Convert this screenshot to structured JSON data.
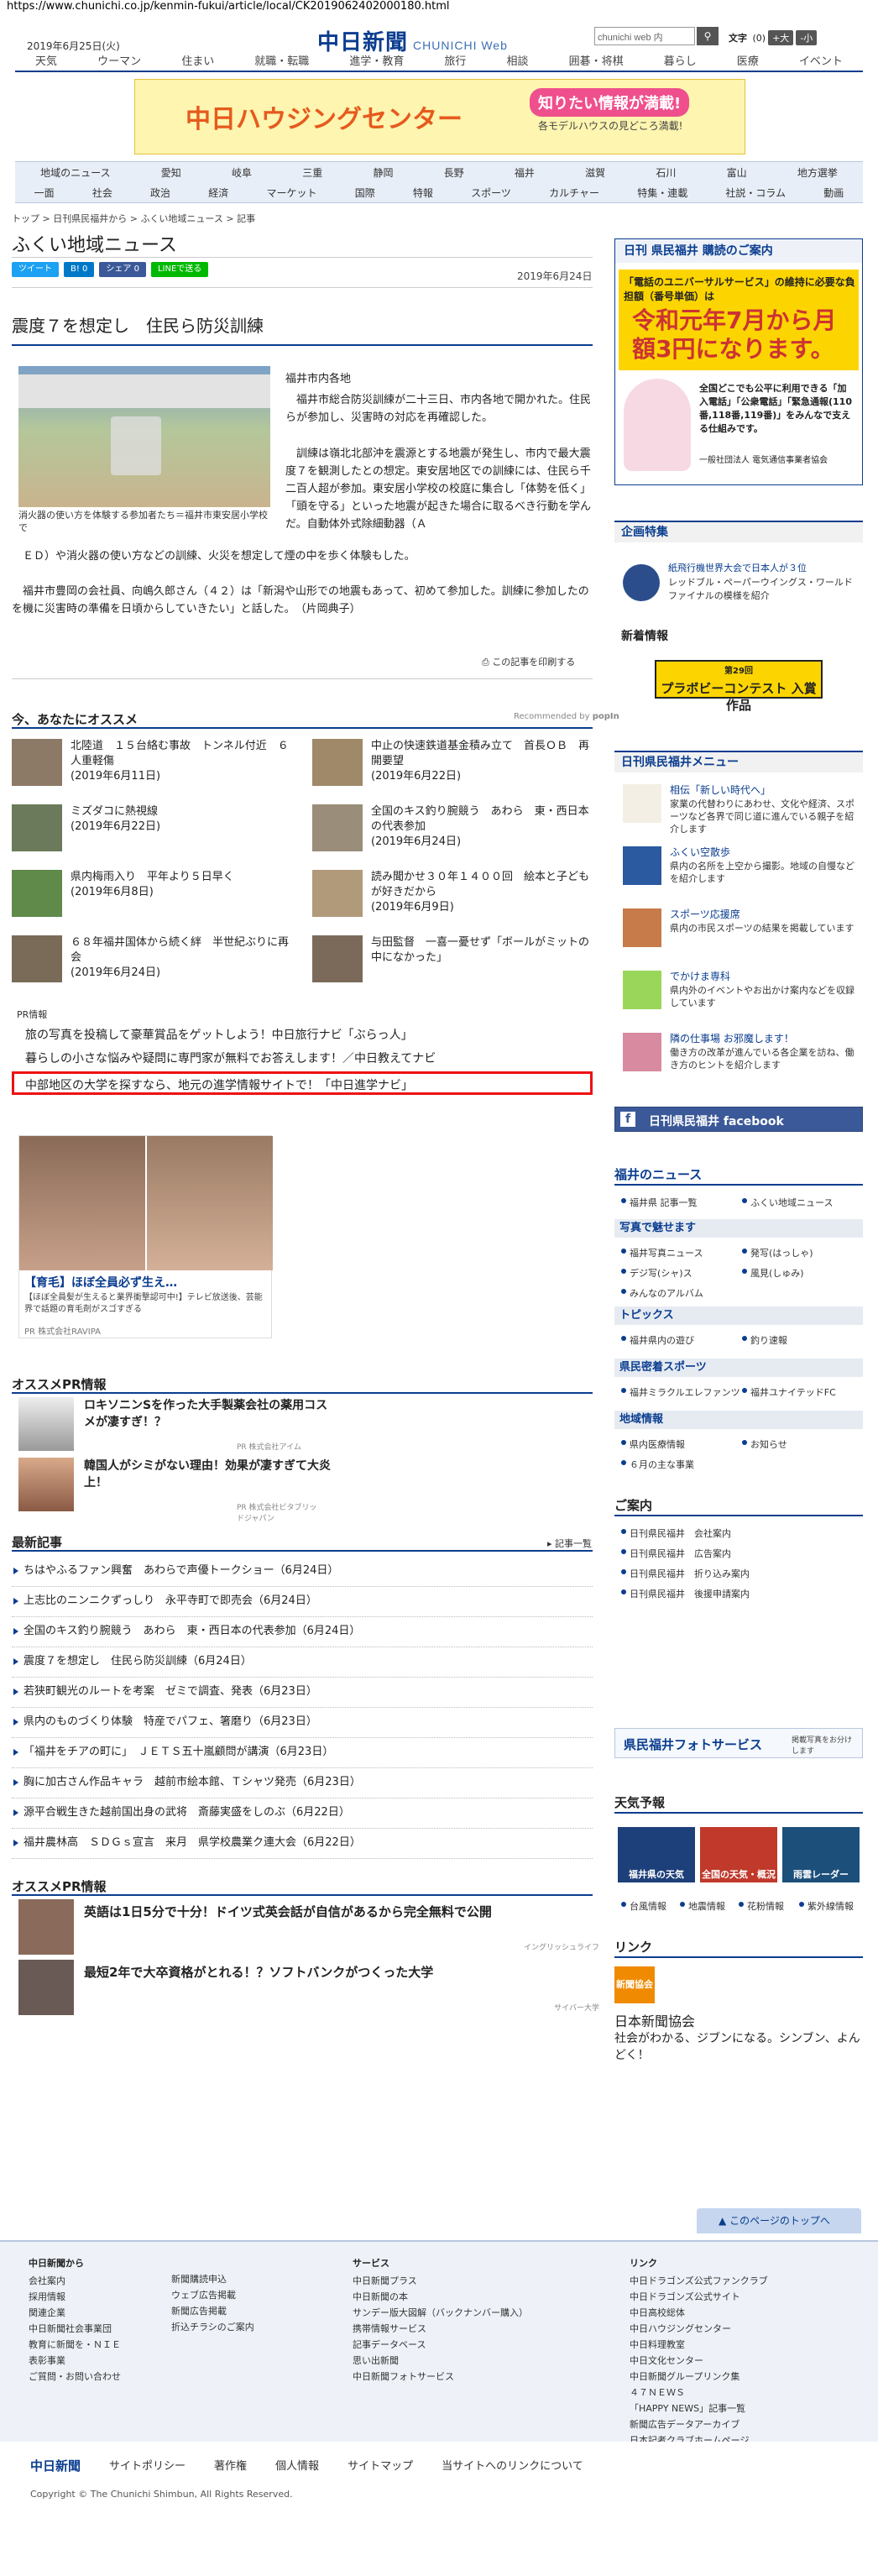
{
  "browser": {
    "url": "https://www.chunichi.co.jp/kenmin-fukui/article/local/CK2019062402000180.html"
  },
  "header": {
    "date": "2019年6月25日(火)",
    "logo": "中日新聞",
    "logo_sub": "CHUNICHI Web",
    "search_placeholder": "chunichi web 内",
    "search_icon": "search-icon",
    "font_label": "文字",
    "font_zero": "(0)",
    "font_large": "+大",
    "font_small": "-小"
  },
  "global_nav": [
    "天気",
    "ウーマン",
    "住まい",
    "就職・転職",
    "進学・教育",
    "旅行",
    "相談",
    "囲碁・将棋",
    "暮らし",
    "医療",
    "イベント"
  ],
  "banner": {
    "title": "中日ハウジングセンター",
    "badge": "知りたい情報が満載!",
    "sub": "各モデルハウスの見どころ満載!"
  },
  "cat_nav": {
    "row1": [
      "地域のニュース",
      "愛知",
      "岐阜",
      "三重",
      "静岡",
      "長野",
      "福井",
      "滋賀",
      "石川",
      "富山",
      "地方選挙"
    ],
    "row2": [
      "一面",
      "社会",
      "政治",
      "経済",
      "マーケット",
      "国際",
      "特報",
      "スポーツ",
      "カルチャー",
      "特集・連載",
      "社説・コラム",
      "動画"
    ]
  },
  "breadcrumb": "トップ > 日刊県民福井から > ふくい地域ニュース > 記事",
  "page_title": "ふくい地域ニュース",
  "social": {
    "tweet": "ツイート",
    "bookmark": "B! 0",
    "share": "シェア 0",
    "line": "LINEで送る"
  },
  "published": "2019年6月24日",
  "article": {
    "title": "震度７を想定し　住民ら防災訓練",
    "byline": "福井市内各地",
    "caption": "消火器の使い方を体験する参加者たち＝福井市東安居小学校で",
    "para1": "福井市総合防災訓練が二十三日、市内各地で開かれた。住民らが参加し、災害時の対応を再確認した。",
    "para2": "訓練は嶺北北部沖を震源とする地震が発生し、市内で最大震度７を観測したとの想定。東安居地区での訓練には、住民ら千二百人超が参加。東安居小学校の校庭に集合し「体勢を低く」「頭を守る」といった地震が起きた場合に取るべき行動を学んだ。自動体外式除細動器（Ａ",
    "para2b": "ＥＤ）や消火器の使い方などの訓練、火災を想定して煙の中を歩く体験もした。",
    "para3": "福井市豊岡の会社員、向嶋久郎さん（４２）は「新潟や山形での地震もあって、初めて参加した。訓練に参加したのを機に災害時の準備を日頃からしていきたい」と話した。　（片岡典子）",
    "print": "この記事を印刷する"
  },
  "reco": {
    "heading": "今、あなたにオススメ",
    "powered": "Recommended by",
    "powered_by": "popIn",
    "items": [
      {
        "title": "北陸道　１５台絡む事故　トンネル付近　６人重軽傷",
        "date": "(2019年6月11日)"
      },
      {
        "title": "中止の快速鉄道基金積み立て　首長ＯＢ　再開要望",
        "date": "(2019年6月22日)"
      },
      {
        "title": "ミズダコに熱視線",
        "date": "(2019年6月22日)"
      },
      {
        "title": "全国のキス釣り腕競う　あわら　東・西日本の代表参加",
        "date": "(2019年6月24日)"
      },
      {
        "title": "県内梅雨入り　平年より５日早く",
        "date": "(2019年6月8日)"
      },
      {
        "title": "読み聞かせ３０年１４００回　絵本と子どもが好きだから",
        "date": "(2019年6月9日)"
      },
      {
        "title": "６８年福井国体から続く絆　半世紀ぶりに再会",
        "date": "(2019年6月24日)"
      },
      {
        "title": "与田監督　一喜一憂せず「ボールがミットの中になかった」",
        "date": ""
      }
    ]
  },
  "pr": {
    "label": "PR情報",
    "links": [
      "旅の写真を投稿して豪華賞品をゲットしよう！中日旅行ナビ「ぶらっ人」",
      "暮らしの小さな悩みや疑問に専門家が無料でお答えします！／中日教えてナビ",
      "中部地区の大学を探すなら、地元の進学情報サイトで！「中日進学ナビ」"
    ]
  },
  "ad": {
    "headline": "【育毛】ほぼ全員必ず生え…",
    "desc": "【ほぼ全員髪が生えると業界衝撃認可中!】テレビ放送後、芸能界で話題の育毛剤がスゴすぎる",
    "sponsor": "PR 株式会社RAVIPA"
  },
  "osusume_pr": {
    "heading": "オススメPR情報",
    "items": [
      {
        "title": "ロキソニンSを作った大手製薬会社の薬用コスメが凄すぎ！？",
        "sponsor": "PR 株式会社アイム"
      },
      {
        "title": "韓国人がシミがない理由！効果が凄すぎて大炎上！",
        "sponsor": "PR 株式会社ビタブリッドジャパン"
      }
    ]
  },
  "latest": {
    "heading": "最新記事",
    "more": "記事一覧",
    "items": [
      "ちはやふるファン興奮　あわらで声優トークショー（6月24日）",
      "上志比のニンニクずっしり　永平寺町で即売会（6月24日）",
      "全国のキス釣り腕競う　あわら　東・西日本の代表参加（6月24日）",
      "震度７を想定し　住民ら防災訓練（6月24日）",
      "若狭町観光のルートを考案　ゼミで調査、発表（6月23日）",
      "県内のものづくり体験　特産でパフェ、箸磨り（6月23日）",
      "「福井をチアの町に」　ＪＥＴＳ五十嵐顧問が講演（6月23日）",
      "胸に加古さん作品キャラ　越前市絵本館、Ｔシャツ発売（6月23日）",
      "源平合戦生きた越前国出身の武将　斎藤実盛をしのぶ（6月22日）",
      "福井農林高　ＳＤＧｓ宣言　来月　県学校農業ク連大会（6月22日）"
    ]
  },
  "osusume_pr2": {
    "heading": "オススメPR情報",
    "items": [
      {
        "title": "英語は1日5分で十分！ドイツ式英会話が自信があるから完全無料で公開",
        "sponsor": "イングリッシュライフ"
      },
      {
        "title": "最短2年で大卒資格がとれる！？ソフトバンクがつくった大学",
        "sponsor": "サイバー大学"
      }
    ]
  },
  "sidebar": {
    "subscribe": {
      "heading": "日刊 県民福井 購読のご案内",
      "notice": "「電話のユニバーサルサービス」の維持に必要な負担額（番号単価）は",
      "price": "令和元年7月から月額3円になります。",
      "body": "全国どこでも公平に利用できる「加入電話」「公衆電話」「緊急通報(110番,118番,119番)」をみんなで支える仕組みです。",
      "org": "一般社団法人 電気通信事業者協会"
    },
    "kikaku": {
      "heading": "企画特集",
      "title": "紙飛行機世界大会で日本人が３位",
      "desc": "レッドブル・ペーパーウイングス・ワールドファイナルの模様を紹介"
    },
    "shinchaku": {
      "heading": "新着情報",
      "contest_line1": "第29回",
      "contest_line2": "プラボビーコンテスト",
      "contest_line3": "入賞作品"
    },
    "menu": {
      "heading": "日刊県民福井メニュー",
      "items": [
        {
          "title": "相伝「新しい時代へ」",
          "desc": "家業の代替わりにあわせ、文化や経済、スポーツなど各界で同じ道に進んでいる親子を紹介します"
        },
        {
          "title": "ふくい空散歩",
          "desc": "県内の名所を上空から撮影。地域の自慢などを紹介します"
        },
        {
          "title": "スポーツ応援席",
          "desc": "県内の市民スポーツの結果を掲載しています"
        },
        {
          "title": "でかけま専科",
          "desc": "県内外のイベントやお出かけ案内などを収録しています"
        },
        {
          "title": "隣の仕事場 お邪魔します！",
          "desc": "働き方の改革が進んでいる各企業を訪ね、働き方のヒントを紹介します"
        }
      ]
    },
    "facebook": "日刊県民福井 facebook",
    "fukui_news": {
      "heading": "福井のニュース",
      "links": [
        "福井県 記事一覧",
        "ふくい地域ニュース"
      ],
      "photo_h": "写真で魅せます",
      "photo_links": [
        "福井写真ニュース",
        "発写(はっしゃ)",
        "デジ写(シャ)ス",
        "風見(しゅみ)",
        "みんなのアルバム"
      ],
      "topics_h": "トピックス",
      "topics_links": [
        "福井県内の遊び",
        "釣り速報"
      ],
      "sports_h": "県民密着スポーツ",
      "sports_links": [
        "福井ミラクルエレファンツ",
        "福井ユナイテッドFC"
      ],
      "area_h": "地域情報",
      "area_links": [
        "県内医療情報",
        "お知らせ",
        "６月の主な事業"
      ]
    },
    "annai": {
      "heading": "ご案内",
      "links": [
        "日刊県民福井　会社案内",
        "日刊県民福井　広告案内",
        "日刊県民福井　折り込み案内",
        "日刊県民福井　後援申請案内"
      ]
    },
    "photo_service": {
      "title": "県民福井フォトサービス",
      "desc": "掲載写真をお分けします"
    },
    "weather": {
      "heading": "天気予報",
      "cards": [
        "福井県の天気",
        "全国の天気・概況",
        "雨雲レーダー"
      ],
      "links": [
        "台風情報",
        "地震情報",
        "花粉情報",
        "紫外線情報"
      ]
    },
    "link": {
      "heading": "リンク",
      "badge": "新聞協会",
      "title": "日本新聞協会",
      "desc": "社会がわかる、ジブンになる。シンブン、よんどく！"
    }
  },
  "to_top": "このページのトップへ",
  "footer": {
    "col1": {
      "heading": "中日新聞から",
      "links": [
        "会社案内",
        "採用情報",
        "関連企業",
        "中日新聞社会事業団",
        "教育に新聞を・ＮＩＥ",
        "表彰事業",
        "ご質問・お問い合わせ"
      ]
    },
    "col2": {
      "links": [
        "新聞購読申込",
        "ウェブ広告掲載",
        "新聞広告掲載",
        "折込チラシのご案内"
      ]
    },
    "col3": {
      "heading": "サービス",
      "links": [
        "中日新聞プラス",
        "中日新聞の本",
        "サンデー版大図解（バックナンバー購入）",
        "携帯情報サービス",
        "記事データベース",
        "思い出新聞",
        "中日新聞フォトサービス"
      ]
    },
    "col4": {
      "heading": "リンク",
      "links": [
        "中日ドラゴンズ公式ファンクラブ",
        "中日ドラゴンズ公式サイト",
        "中日高校総体",
        "中日ハウジングセンター",
        "中日料理教室",
        "中日文化センター",
        "中日新聞グループリンク集",
        "４７ＮＥＷＳ",
        "「HAPPY NEWS」記事一覧",
        "新聞広告データアーカイブ",
        "日本記者クラブホームページ"
      ]
    },
    "bar": [
      "中日新聞",
      "サイトポリシー",
      "著作権",
      "個人情報",
      "サイトマップ",
      "当サイトへのリンクについて"
    ],
    "copyright": "Copyright © The Chunichi Shimbun, All Rights Reserved."
  }
}
